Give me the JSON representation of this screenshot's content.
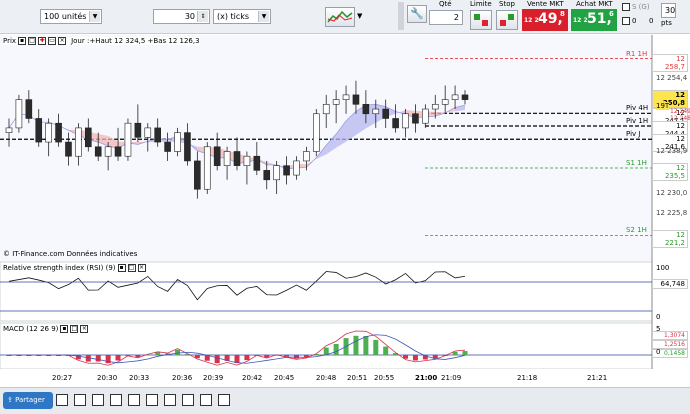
{
  "toolbar": {
    "quantity_units": "100 unités",
    "interval_value": "30",
    "interval_unit": "(x) ticks",
    "qty_label": "Qté",
    "qty_value": "2",
    "limit_label": "Limite",
    "stop_label": "Stop",
    "sell_label": "Vente MKT",
    "sell_prefix": "12 2",
    "sell_big": "49,",
    "sell_small": "8",
    "buy_label": "Achat MKT",
    "buy_prefix": "12 2",
    "buy_big": "51,",
    "buy_small": "6",
    "s_label": "S (G)",
    "s_value": "0",
    "zero_label": "0",
    "pts_value": "30",
    "pts_label": "pts"
  },
  "price_pane": {
    "title": "Prix",
    "info": "Jour :+Haut 12 324,5 +Bas 12 126,3",
    "footer": "© IT-Finance.com Données indicatives",
    "levels": [
      {
        "label": "R1 1H",
        "value": "12 258,7",
        "color": "#e23a3a"
      },
      {
        "label": "Piv 4H",
        "value": "12 247,1",
        "color": "#000000"
      },
      {
        "label": "Piv 1H",
        "value": "12 244,4",
        "color": "#000000"
      },
      {
        "label": "Piv J",
        "value": "12 241,6",
        "color": "#000000"
      },
      {
        "label": "S1 1H",
        "value": "12 235,5",
        "color": "#2a9a2a"
      },
      {
        "label": "S2 1H",
        "value": "12 221,2",
        "color": "#2a9a2a"
      }
    ],
    "yticks": [
      "12 254,4",
      "12 238,9",
      "12 230,0",
      "12 225,8"
    ],
    "current": "12 250,8",
    "current_tag": "19T",
    "small_vals": [
      "12 249,7",
      "12 248,5"
    ]
  },
  "rsi_pane": {
    "title": "Relative strength index (RSI) (9)",
    "ticks": [
      "100",
      "0"
    ],
    "value": "64,748"
  },
  "macd_pane": {
    "title": "MACD (12 26 9)",
    "ticks": [
      "5",
      "0"
    ],
    "values": [
      "1,3074",
      "1,2516",
      "0,1458"
    ]
  },
  "xaxis": {
    "ticks": [
      "20:27",
      "20:30",
      "20:33",
      "20:36",
      "20:39",
      "20:42",
      "20:45",
      "20:48",
      "20:51",
      "20:55",
      "21:00",
      "21:09",
      "21:18",
      "21:21"
    ]
  },
  "bottombar": {
    "share_label": "Partager"
  },
  "colors": {
    "sell": "#d8202c",
    "buy": "#21a243",
    "up": "#ffffff",
    "down": "#2b2b2b",
    "macd_bar": "#4caf50",
    "macd_neg": "#d8324a"
  },
  "chart_data": {
    "type": "candlestick",
    "candles": [
      [
        12243,
        12246,
        12240,
        12244
      ],
      [
        12244,
        12251,
        12243,
        12250
      ],
      [
        12250,
        12252,
        12245,
        12246
      ],
      [
        12246,
        12248,
        12240,
        12241
      ],
      [
        12241,
        12246,
        12238,
        12245
      ],
      [
        12245,
        12247,
        12240,
        12241
      ],
      [
        12241,
        12243,
        12236,
        12238
      ],
      [
        12238,
        12245,
        12236,
        12244
      ],
      [
        12244,
        12246,
        12239,
        12240
      ],
      [
        12240,
        12243,
        12237,
        12238
      ],
      [
        12238,
        12241,
        12235,
        12240
      ],
      [
        12240,
        12244,
        12237,
        12238
      ],
      [
        12238,
        12246,
        12237,
        12245
      ],
      [
        12245,
        12249,
        12241,
        12242
      ],
      [
        12242,
        12245,
        12239,
        12244
      ],
      [
        12244,
        12246,
        12240,
        12241
      ],
      [
        12241,
        12243,
        12237,
        12239
      ],
      [
        12239,
        12244,
        12238,
        12243
      ],
      [
        12243,
        12245,
        12236,
        12237
      ],
      [
        12237,
        12239,
        12229,
        12231
      ],
      [
        12231,
        12241,
        12230,
        12240
      ],
      [
        12240,
        12243,
        12235,
        12236
      ],
      [
        12236,
        12240,
        12233,
        12239
      ],
      [
        12239,
        12242,
        12235,
        12236
      ],
      [
        12236,
        12239,
        12232,
        12238
      ],
      [
        12238,
        12241,
        12234,
        12235
      ],
      [
        12235,
        12237,
        12231,
        12233
      ],
      [
        12233,
        12237,
        12230,
        12236
      ],
      [
        12236,
        12238,
        12232,
        12234
      ],
      [
        12234,
        12238,
        12233,
        12237
      ],
      [
        12237,
        12240,
        12235,
        12239
      ],
      [
        12239,
        12248,
        12238,
        12247
      ],
      [
        12247,
        12251,
        12244,
        12249
      ],
      [
        12249,
        12252,
        12245,
        12250
      ],
      [
        12250,
        12253,
        12247,
        12251
      ],
      [
        12251,
        12254,
        12247,
        12249
      ],
      [
        12249,
        12252,
        12245,
        12247
      ],
      [
        12247,
        12250,
        12244,
        12248
      ],
      [
        12248,
        12250,
        12244,
        12246
      ],
      [
        12246,
        12249,
        12243,
        12244
      ],
      [
        12244,
        12248,
        12242,
        12247
      ],
      [
        12247,
        12249,
        12243,
        12245
      ],
      [
        12245,
        12249,
        12244,
        12248
      ],
      [
        12248,
        12251,
        12246,
        12249
      ],
      [
        12249,
        12253,
        12247,
        12250
      ],
      [
        12250,
        12253,
        12248,
        12251
      ],
      [
        12251,
        12252,
        12249,
        12250
      ]
    ],
    "ylim": [
      12216,
      12262
    ]
  }
}
